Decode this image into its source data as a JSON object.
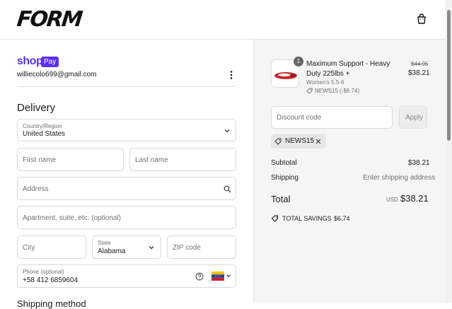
{
  "brand": {
    "logo": "FORM"
  },
  "header": {
    "cart_icon": "shopping-bag-icon"
  },
  "account": {
    "shop_label": "shop",
    "pay_badge": "Pay",
    "email": "williecolo699@gmail.com"
  },
  "delivery": {
    "heading": "Delivery",
    "country": {
      "label": "Country/Region",
      "value": "United States"
    },
    "first_name": {
      "placeholder": "First name"
    },
    "last_name": {
      "placeholder": "Last name"
    },
    "address": {
      "placeholder": "Address"
    },
    "apartment": {
      "placeholder": "Apartment, suite, etc. (optional)"
    },
    "city": {
      "placeholder": "City"
    },
    "state": {
      "label": "State",
      "value": "Alabama"
    },
    "zip": {
      "placeholder": "ZIP code"
    },
    "phone": {
      "label": "Phone (optional)",
      "value": "+58 412 6859604"
    }
  },
  "shipping_method": {
    "heading": "Shipping method"
  },
  "summary": {
    "item": {
      "quantity": "1",
      "name": "Maximum Support - Heavy Duty 225lbs +",
      "variant": "Women's 5.5-6",
      "discount_tag": "NEWS15 (-$6.74)",
      "original_price": "$44.95",
      "price": "$38.21"
    },
    "discount": {
      "placeholder": "Discount code",
      "apply_label": "Apply",
      "applied_code": "NEWS15"
    },
    "subtotal": {
      "label": "Subtotal",
      "value": "$38.21"
    },
    "shipping": {
      "label": "Shipping",
      "value": "Enter shipping address"
    },
    "total": {
      "label": "Total",
      "currency": "USD",
      "value": "$38.21"
    },
    "savings": {
      "label": "TOTAL SAVINGS",
      "value": "$6.74"
    }
  },
  "colors": {
    "shop_pay": "#5a31f4",
    "panel_bg": "#f5f5f5"
  }
}
